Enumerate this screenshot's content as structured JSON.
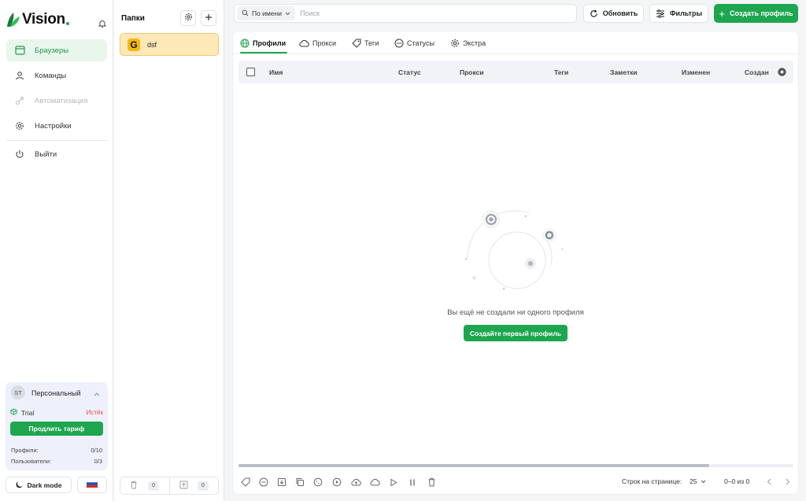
{
  "app": {
    "brand": "Vision"
  },
  "sidebar": {
    "items": [
      {
        "label": "Браузеры",
        "icon": "browser-icon",
        "active": true
      },
      {
        "label": "Команды",
        "icon": "user-icon"
      },
      {
        "label": "Автоматизация",
        "icon": "automation-icon",
        "disabled": true
      },
      {
        "label": "Настройки",
        "icon": "gear-icon"
      }
    ],
    "logout_label": "Выйти",
    "plan": {
      "avatar_initials": "ST",
      "workspace": "Персональный",
      "trial_label": "Trial",
      "status": "Истёк",
      "extend_label": "Продлить тариф",
      "profiles_label": "Профили:",
      "profiles_value": "0/10",
      "users_label": "Пользователи:",
      "users_value": "0/3"
    },
    "dark_mode_label": "Dark mode",
    "language_flag": "ru-flag-icon"
  },
  "folders": {
    "title": "Папки",
    "items": [
      {
        "initial": "G",
        "name": "dsf"
      }
    ],
    "trash_count": "0",
    "archive_count": "0"
  },
  "topbar": {
    "search_mode": "По имени",
    "search_placeholder": "Поиск",
    "refresh_label": "Обновить",
    "filters_label": "Фильтры",
    "create_label": "Создать профиль"
  },
  "tabs": [
    {
      "label": "Профили",
      "icon": "globe-icon",
      "active": true
    },
    {
      "label": "Прокси",
      "icon": "cloud-icon"
    },
    {
      "label": "Теги",
      "icon": "tag-icon"
    },
    {
      "label": "Статусы",
      "icon": "status-icon"
    },
    {
      "label": "Экстра",
      "icon": "gear-icon"
    }
  ],
  "table": {
    "columns": [
      "Имя",
      "Статус",
      "Прокси",
      "Теги",
      "Заметки",
      "Изменен",
      "Создан"
    ]
  },
  "empty_state": {
    "message": "Вы ещё не создали ни одного профиля",
    "button_label": "Создайте первый профиль"
  },
  "pagination": {
    "rows_label": "Строк на странице:",
    "rows_value": "25",
    "range": "0–0 из 0"
  },
  "colors": {
    "accent": "#1ea64f",
    "accent_bg": "#e8f6ec",
    "folder_bg": "#fde8b8",
    "danger": "#e04848"
  }
}
